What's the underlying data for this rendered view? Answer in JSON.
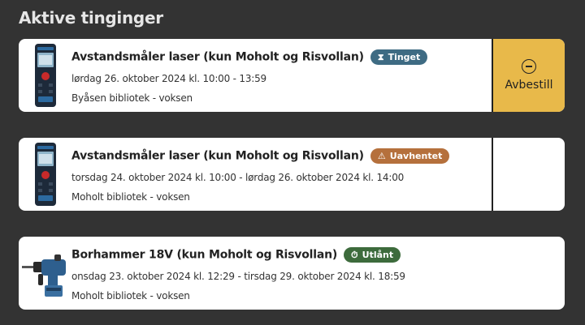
{
  "page_title": "Aktive tinginger",
  "colors": {
    "background": "#333333",
    "reserved_badge": "#3e6b83",
    "uncollected_badge": "#b5703c",
    "loaned_badge": "#3d6b3c",
    "cancel_button": "#e8b94a"
  },
  "items": [
    {
      "title": "Avstandsmåler laser (kun Moholt og Risvollan)",
      "status": "Tinget",
      "status_icon": "hourglass-icon",
      "date": "lørdag 26. oktober 2024 kl. 10:00 - 13:59",
      "location": "Byåsen bibliotek - voksen",
      "image": "laser-distance-meter",
      "action": "Avbestill"
    },
    {
      "title": "Avstandsmåler laser (kun Moholt og Risvollan)",
      "status": "Uavhentet",
      "status_icon": "warning-icon",
      "date": "torsdag 24. oktober 2024 kl. 10:00 - lørdag 26. oktober 2024 kl. 14:00",
      "location": "Moholt bibliotek - voksen",
      "image": "laser-distance-meter"
    },
    {
      "title": "Borhammer 18V (kun Moholt og Risvollan)",
      "status": "Utlånt",
      "status_icon": "stopwatch-icon",
      "date": "onsdag 23. oktober 2024 kl. 12:29 - tirsdag 29. oktober 2024 kl. 18:59",
      "location": "Moholt bibliotek - voksen",
      "image": "rotary-hammer-drill"
    }
  ]
}
